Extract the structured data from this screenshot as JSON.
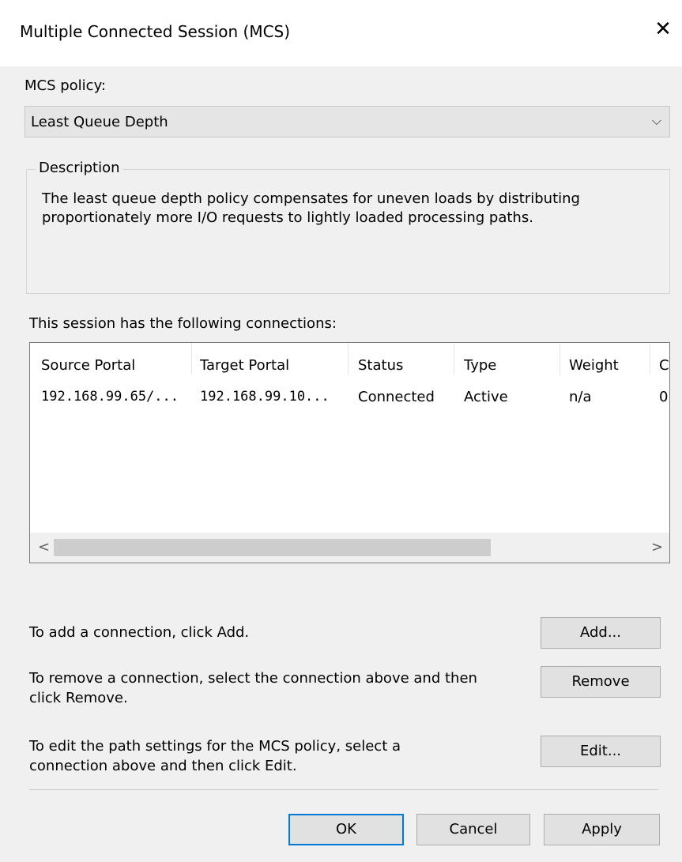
{
  "window": {
    "title": "Multiple Connected Session (MCS)",
    "close_glyph": "✕"
  },
  "policy": {
    "label": "MCS policy:",
    "selected": "Least Queue Depth",
    "chevron_glyph": "⌵"
  },
  "description": {
    "legend": "Description",
    "line1": "The least queue depth policy compensates for uneven loads by distributing",
    "line2": "proportionately more I/O requests to lightly loaded processing paths."
  },
  "connections": {
    "label": "This session has the following connections:",
    "columns": [
      "Source Portal",
      "Target Portal",
      "Status",
      "Type",
      "Weight",
      "C"
    ],
    "rows": [
      [
        "192.168.99.65/...",
        "192.168.99.10...",
        "Connected",
        "Active",
        "n/a",
        "0"
      ]
    ],
    "scroll_left_glyph": "<",
    "scroll_right_glyph": ">"
  },
  "actions": {
    "add_text": "To add a connection, click Add.",
    "add_button": "Add...",
    "remove_text_line1": "To remove a connection, select the connection above and then",
    "remove_text_line2": "click Remove.",
    "remove_button": "Remove",
    "edit_text_line1": "To edit the path settings for the MCS policy, select a",
    "edit_text_line2": "connection above and then click Edit.",
    "edit_button": "Edit..."
  },
  "footer": {
    "ok": "OK",
    "cancel": "Cancel",
    "apply": "Apply"
  },
  "colors": {
    "accent": "#0078d7",
    "window_bg": "#f0f0f0"
  }
}
